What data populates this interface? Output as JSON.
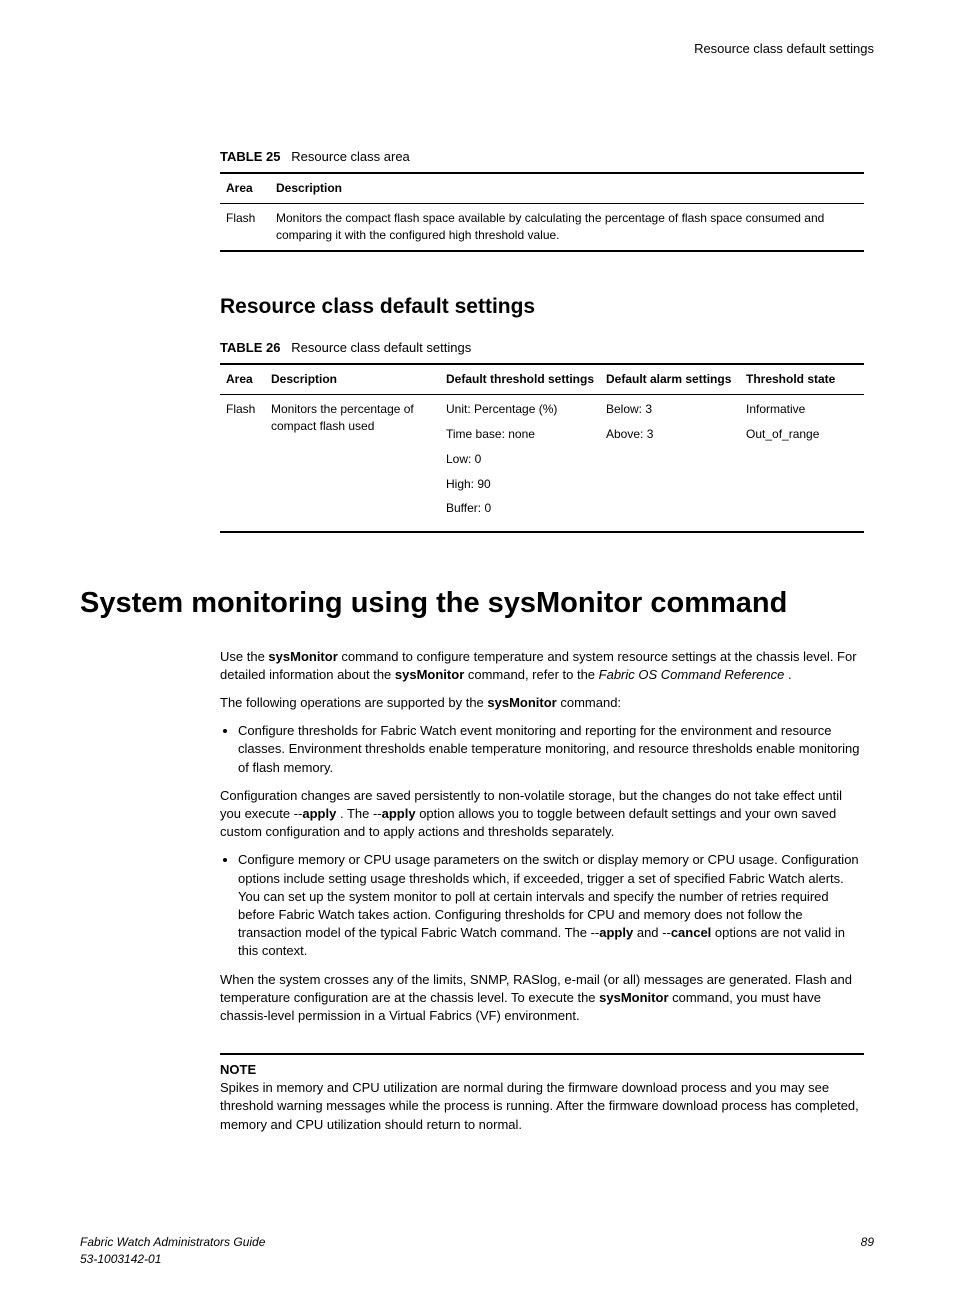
{
  "header": {
    "right": "Resource class default settings"
  },
  "table25": {
    "caption_label": "TABLE 25",
    "caption_text": "Resource class area",
    "headers": [
      "Area",
      "Description"
    ],
    "row": {
      "area": "Flash",
      "desc": "Monitors the compact flash space available by calculating the percentage of flash space consumed and comparing it with the configured high threshold value."
    }
  },
  "section_heading": "Resource class default settings",
  "table26": {
    "caption_label": "TABLE 26",
    "caption_text": "Resource class default settings",
    "headers": [
      "Area",
      "Description",
      "Default threshold settings",
      "Default alarm settings",
      "Threshold state"
    ],
    "row": {
      "area": "Flash",
      "desc": "Monitors the percentage of compact flash used",
      "threshold": [
        "Unit: Percentage (%)",
        "Time base: none",
        "Low: 0",
        "High: 90",
        "Buffer: 0"
      ],
      "alarm": [
        "Below: 3",
        "Above: 3"
      ],
      "state": [
        "Informative",
        "Out_of_range"
      ]
    }
  },
  "main_heading": "System monitoring using the sysMonitor command",
  "body": {
    "p1a": "Use the ",
    "p1b": "sysMonitor",
    "p1c": " command to configure temperature and system resource settings at the chassis level. For detailed information about the ",
    "p1d": "sysMonitor",
    "p1e": " command, refer to the ",
    "p1f": "Fabric OS Command Reference",
    "p1g": " .",
    "p2a": "The following operations are supported by the ",
    "p2b": "sysMonitor",
    "p2c": " command:",
    "bullet1": "Configure thresholds for Fabric Watch event monitoring and reporting for the environment and resource classes. Environment thresholds enable temperature monitoring, and resource thresholds enable monitoring of flash memory.",
    "p3a": "Configuration changes are saved persistently to non-volatile storage, but the changes do not take effect until you execute --",
    "p3b": "apply",
    "p3c": " . The --",
    "p3d": "apply",
    "p3e": " option allows you to toggle between default settings and your own saved custom configuration and to apply actions and thresholds separately.",
    "bullet2a": "Configure memory or CPU usage parameters on the switch or display memory or CPU usage. Configuration options include setting usage thresholds which, if exceeded, trigger a set of specified Fabric Watch alerts. You can set up the system monitor to poll at certain intervals and specify the number of retries required before Fabric Watch takes action. Configuring thresholds for CPU and memory does not follow the transaction model of the typical Fabric Watch command. The --",
    "bullet2b": "apply",
    "bullet2c": " and --",
    "bullet2d": "cancel",
    "bullet2e": " options are not valid in this context.",
    "p4a": "When the system crosses any of the limits, SNMP, RASlog, e-mail (or all) messages are generated. Flash and temperature configuration are at the chassis level. To execute the ",
    "p4b": "sysMonitor",
    "p4c": " command, you must have chassis-level permission in a Virtual Fabrics (VF) environment.",
    "note_label": "NOTE",
    "note_text": "Spikes in memory and CPU utilization are normal during the firmware download process and you may see threshold warning messages while the process is running. After the firmware download process has completed, memory and CPU utilization should return to normal."
  },
  "footer": {
    "left1": "Fabric Watch Administrators Guide",
    "left2": "53-1003142-01",
    "right": "89"
  }
}
